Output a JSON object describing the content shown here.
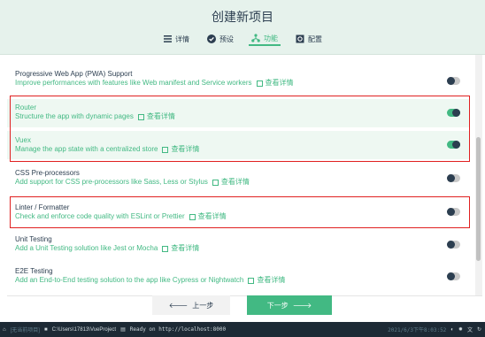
{
  "header": {
    "title": "创建新项目"
  },
  "tabs": [
    {
      "label": "详情",
      "icon": "list-icon"
    },
    {
      "label": "预设",
      "icon": "check-circle-icon"
    },
    {
      "label": "功能",
      "icon": "branch-icon",
      "active": true
    },
    {
      "label": "配置",
      "icon": "settings-icon"
    }
  ],
  "features": [
    {
      "name": "Progressive Web App (PWA) Support",
      "desc": "Improve performances with features like Web manifest and Service workers",
      "link": "查看详情",
      "enabled": false
    },
    {
      "name": "Router",
      "desc": "Structure the app with dynamic pages",
      "link": "查看详情",
      "enabled": true
    },
    {
      "name": "Vuex",
      "desc": "Manage the app state with a centralized store",
      "link": "查看详情",
      "enabled": true
    },
    {
      "name": "CSS Pre-processors",
      "desc": "Add support for CSS pre-processors like Sass, Less or Stylus",
      "link": "查看详情",
      "enabled": false
    },
    {
      "name": "Linter / Formatter",
      "desc": "Check and enforce code quality with ESLint or Prettier",
      "link": "查看详情",
      "enabled": false
    },
    {
      "name": "Unit Testing",
      "desc": "Add a Unit Testing solution like Jest or Mocha",
      "link": "查看详情",
      "enabled": false
    },
    {
      "name": "E2E Testing",
      "desc": "Add an End-to-End testing solution to the app like Cypress or Nightwatch",
      "link": "查看详情",
      "enabled": false
    }
  ],
  "footer": {
    "prev": "上一步",
    "next": "下一步"
  },
  "taskbar": {
    "project": "[无当前项目]",
    "path": "C:\\Users\\17813\\VueProject",
    "status": "Ready on http://localhost:8000",
    "datetime": "2021/6/3下午8:03:52"
  },
  "colors": {
    "accent": "#42b983",
    "text": "#2c3e50",
    "highlight": "#e02020"
  }
}
